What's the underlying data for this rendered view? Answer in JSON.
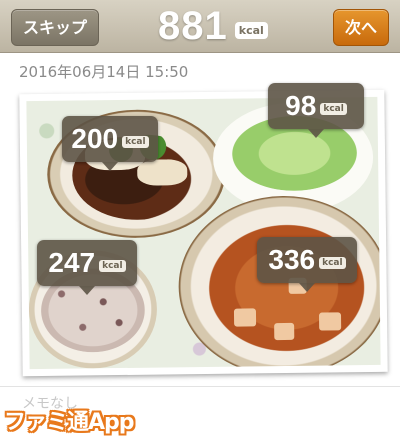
{
  "header": {
    "skip_label": "スキップ",
    "total_kcal": "881",
    "unit": "kcal",
    "next_label": "次へ"
  },
  "entry": {
    "datetime": "2016年06月14日 15:50"
  },
  "photo": {
    "callouts": [
      {
        "dish": "pork-with-sauce",
        "kcal": "200",
        "unit": "kcal"
      },
      {
        "dish": "cabbage-salad",
        "kcal": "98",
        "unit": "kcal"
      },
      {
        "dish": "multigrain-rice",
        "kcal": "247",
        "unit": "kcal"
      },
      {
        "dish": "mapo-tofu",
        "kcal": "336",
        "unit": "kcal"
      }
    ]
  },
  "memo": {
    "placeholder": "メモなし"
  },
  "watermark": {
    "text": "ファミ通App"
  },
  "colors": {
    "header_bg": "#c9c2b1",
    "skip_button": "#8a8373",
    "next_button": "#d97a1a",
    "callout_bg": "#5d5446",
    "watermark_orange": "#e8791c"
  }
}
